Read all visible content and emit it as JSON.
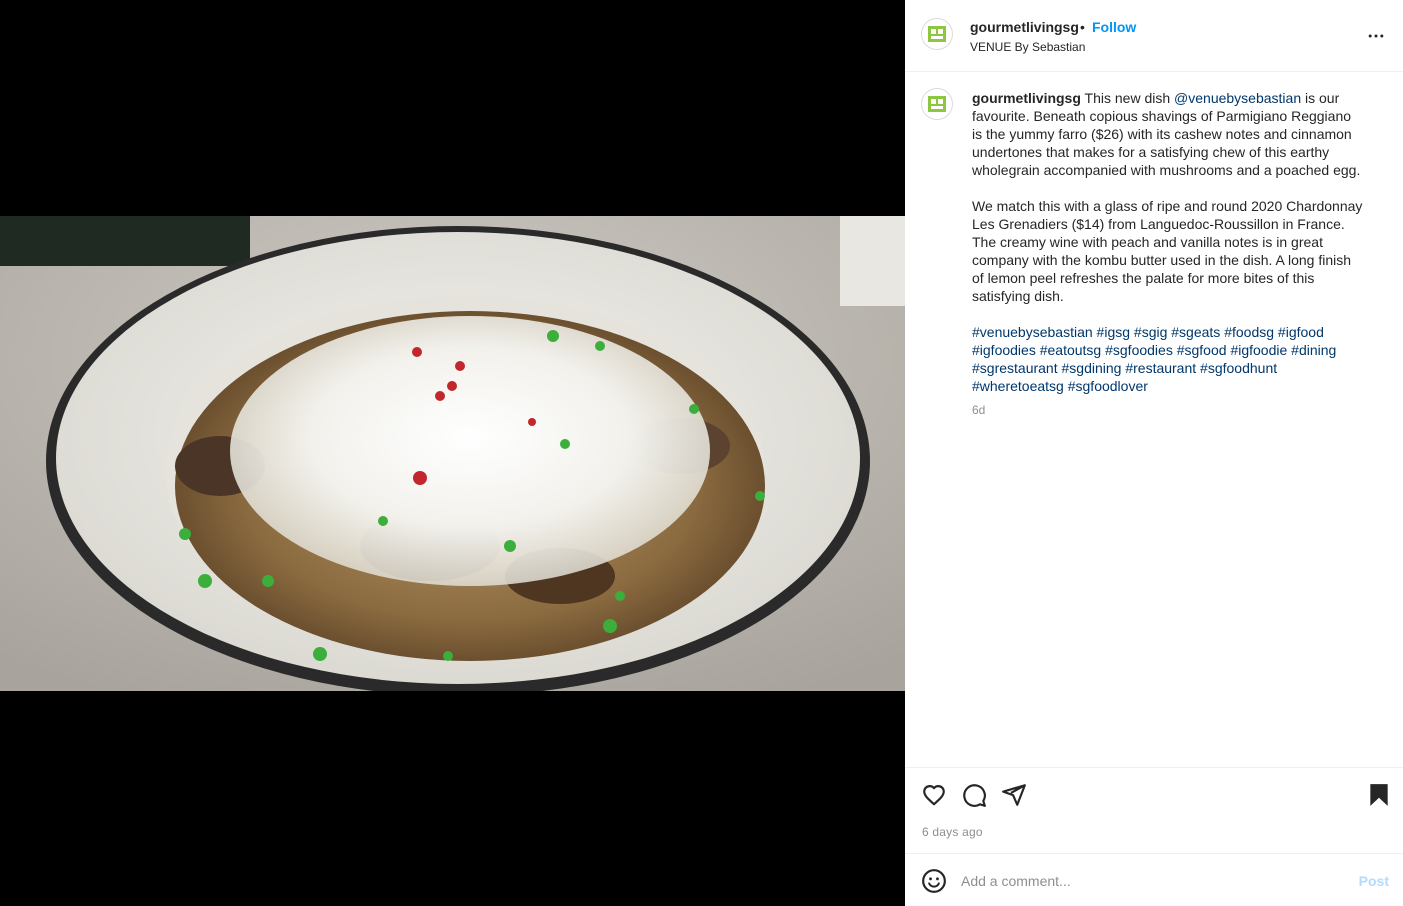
{
  "post": {
    "username": "gourmetlivingsg",
    "dot": "•",
    "follow_label": "Follow",
    "location": "VENUE By Sebastian",
    "more_icon": "more-horizontal-icon"
  },
  "caption": {
    "username": "gourmetlivingsg",
    "p1_before": " This new dish ",
    "mention": "@venuebysebastian",
    "p1_after": " is our favourite. Beneath copious shavings of Parmigiano Reggiano is the yummy farro ($26) with its cashew notes and cinnamon undertones that makes for a satisfying chew of this earthy wholegrain accompanied with mushrooms and a poached egg.",
    "p2": "We match this with a glass of ripe and round 2020 Chardonnay Les Grenadiers ($14) from Languedoc-Roussillon in France. The creamy wine with peach and vanilla notes is in great company with the kombu butter used in the dish. A long finish of lemon peel refreshes the palate for more bites of this satisfying dish.",
    "hashtags": [
      "#venuebysebastian",
      "#igsg",
      "#sgig",
      "#sgeats",
      "#foodsg",
      "#igfood",
      "#igfoodies",
      "#eatoutsg",
      "#sgfoodies",
      "#sgfood",
      "#igfoodie",
      "#dining",
      "#sgrestaurant",
      "#sgdining",
      "#restaurant",
      "#sgfoodhunt",
      "#wheretoeatsg",
      "#sgfoodlover"
    ],
    "age": "6d"
  },
  "actions": {
    "like_icon": "heart-icon",
    "comment_icon": "comment-icon",
    "share_icon": "share-icon",
    "save_icon": "bookmark-icon"
  },
  "timestamp": "6 days ago",
  "comment": {
    "placeholder": "Add a comment...",
    "post_label": "Post"
  },
  "colors": {
    "link": "#0095f6",
    "hashtag": "#00376b",
    "muted": "#8e8e8e",
    "post_disabled": "#b3dbff",
    "logo_green": "#8dc63f"
  }
}
